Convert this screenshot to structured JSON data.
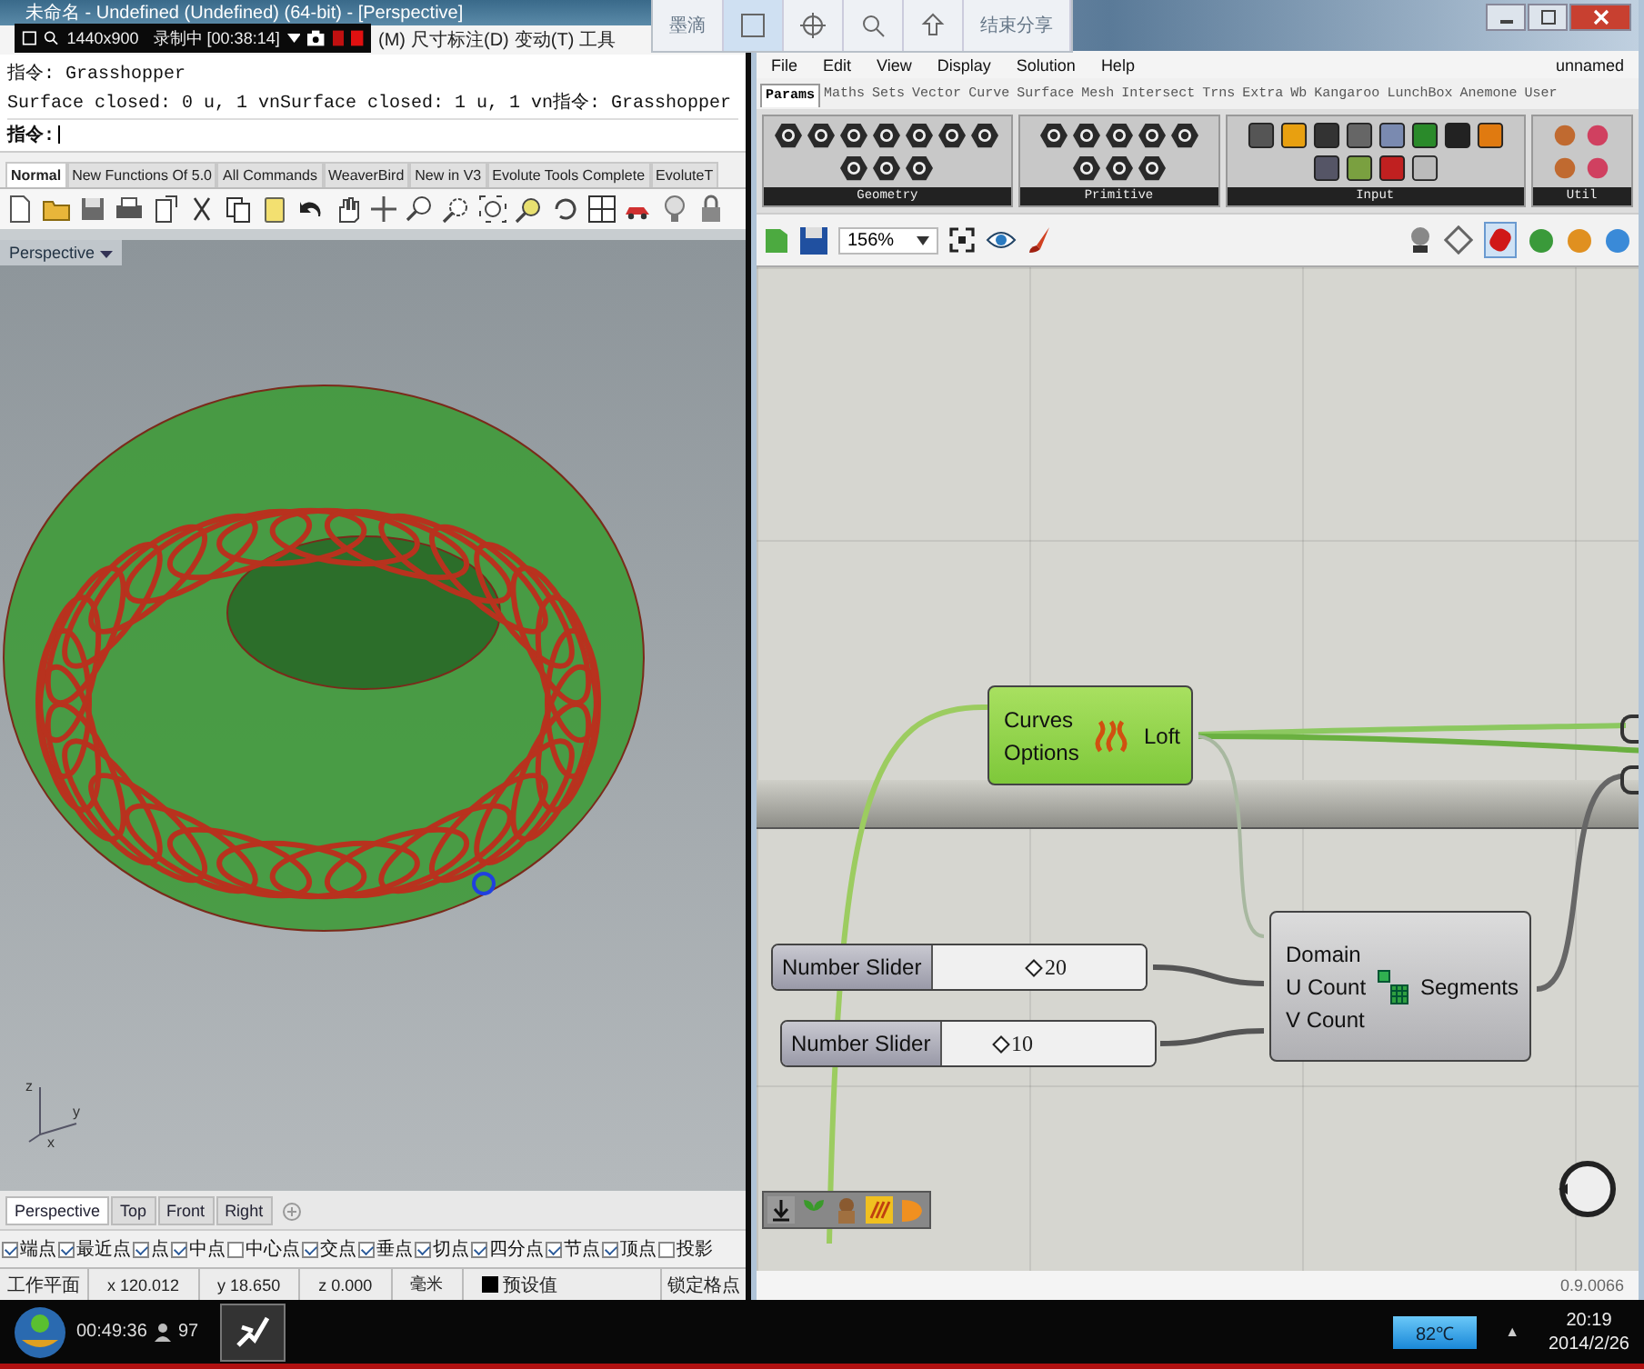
{
  "rhino": {
    "title": "未命名 - Undefined (Undefined) (64-bit) - [Perspective]",
    "recorder": {
      "resolution": "1440x900",
      "status": "录制中 [00:38:14]"
    },
    "menu": [
      "(M)",
      "尺寸标注(D)",
      "变动(T)",
      "工具"
    ],
    "command_history": [
      "指令: Grasshopper",
      "Surface closed: 0 u, 1 vnSurface closed: 1 u, 1 vn指令: Grasshopper"
    ],
    "command_prompt": "指令:",
    "toolbar_tabs": [
      {
        "label": "Normal",
        "selected": true
      },
      {
        "label": "New Functions Of 5.0",
        "selected": false
      },
      {
        "label": "All Commands",
        "selected": false
      },
      {
        "label": "WeaverBird",
        "selected": false
      },
      {
        "label": "New in V3",
        "selected": false
      },
      {
        "label": "Evolute Tools Complete",
        "selected": false
      },
      {
        "label": "EvoluteT",
        "selected": false
      }
    ],
    "viewport": {
      "label": "Perspective",
      "axis_labels": [
        "z",
        "y",
        "x"
      ]
    },
    "view_tabs": [
      {
        "label": "Perspective",
        "selected": true
      },
      {
        "label": "Top",
        "selected": false
      },
      {
        "label": "Front",
        "selected": false
      },
      {
        "label": "Right",
        "selected": false
      }
    ],
    "osnaps": [
      {
        "label": "端点",
        "checked": true
      },
      {
        "label": "最近点",
        "checked": true
      },
      {
        "label": "点",
        "checked": true
      },
      {
        "label": "中点",
        "checked": true
      },
      {
        "label": "中心点",
        "checked": false
      },
      {
        "label": "交点",
        "checked": true
      },
      {
        "label": "垂点",
        "checked": true
      },
      {
        "label": "切点",
        "checked": true
      },
      {
        "label": "四分点",
        "checked": true
      },
      {
        "label": "节点",
        "checked": true
      },
      {
        "label": "顶点",
        "checked": true
      },
      {
        "label": "投影",
        "checked": false
      }
    ],
    "status_bar": [
      "工作平面",
      "x 120.012",
      "y 18.650",
      "z 0.000",
      "毫米"
    ],
    "layer": "预设值",
    "grid_snap": "锁定格点"
  },
  "share_toolbar": {
    "first": "墨滴",
    "end": "结束分享"
  },
  "grasshopper": {
    "menu": [
      "File",
      "Edit",
      "View",
      "Display",
      "Solution",
      "Help"
    ],
    "document": "unnamed",
    "tabs": [
      {
        "label": "Params",
        "selected": true
      },
      {
        "label": "Maths",
        "selected": false
      },
      {
        "label": "Sets",
        "selected": false
      },
      {
        "label": "Vector",
        "selected": false
      },
      {
        "label": "Curve",
        "selected": false
      },
      {
        "label": "Surface",
        "selected": false
      },
      {
        "label": "Mesh",
        "selected": false
      },
      {
        "label": "Intersect",
        "selected": false
      },
      {
        "label": "Trns",
        "selected": false
      },
      {
        "label": "Extra",
        "selected": false
      },
      {
        "label": "Wb",
        "selected": false
      },
      {
        "label": "Kangaroo",
        "selected": false
      },
      {
        "label": "LunchBox",
        "selected": false
      },
      {
        "label": "Anemone",
        "selected": false
      },
      {
        "label": "User",
        "selected": false
      }
    ],
    "panels": [
      "Geometry",
      "Primitive",
      "Input",
      "Util"
    ],
    "zoom": "156%",
    "loft": {
      "inputs": [
        "Curves",
        "Options"
      ],
      "output": "Loft"
    },
    "sliders": [
      {
        "label": "Number Slider",
        "value": "20",
        "level": 0.45
      },
      {
        "label": "Number Slider",
        "value": "10",
        "level": 0.25
      }
    ],
    "segments": {
      "inputs": [
        "Domain",
        "U Count",
        "V Count"
      ],
      "output": "Segments"
    },
    "version": "0.9.0066"
  },
  "taskbar": {
    "timer": "00:49:36",
    "count": "97",
    "temperature": "82℃",
    "tray_arrow": "▲",
    "clock": "20:19",
    "date": "2014/2/26"
  }
}
